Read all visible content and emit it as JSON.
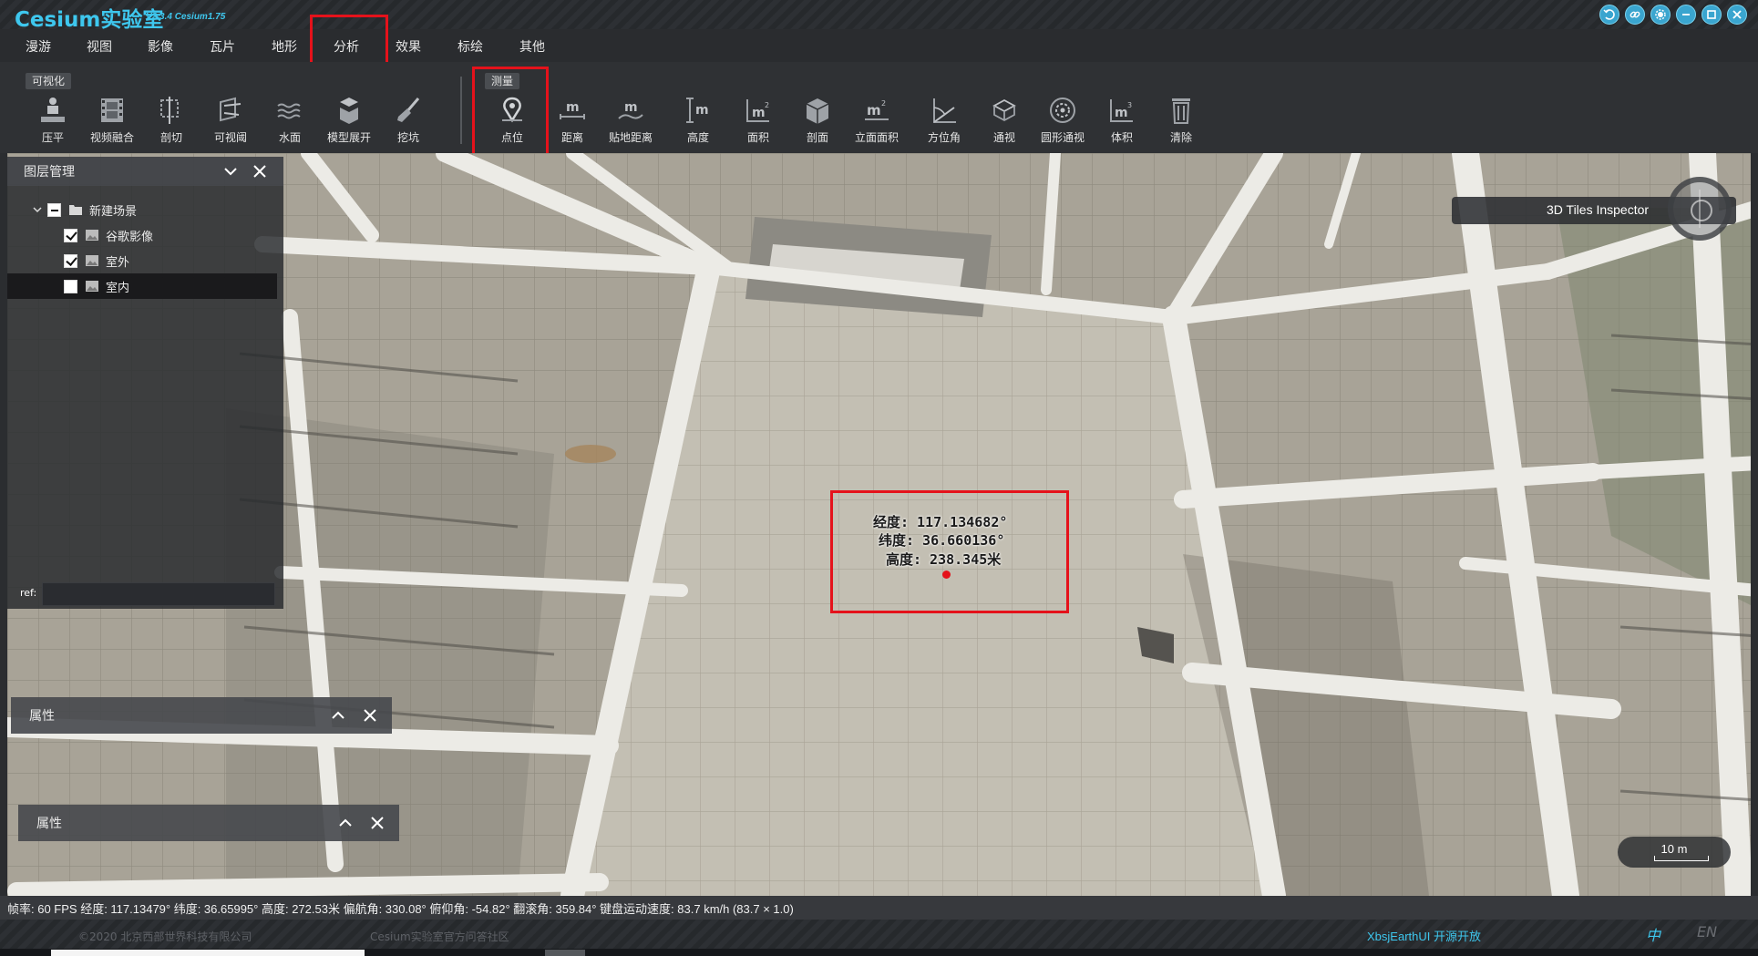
{
  "app": {
    "title": "Cesium实验室",
    "version": "V2.3.4  Cesium1.75"
  },
  "window_controls": [
    "undo-icon",
    "link-icon",
    "settings-icon",
    "minimize-icon",
    "maximize-icon",
    "close-icon"
  ],
  "menu": {
    "items": [
      "漫游",
      "视图",
      "影像",
      "瓦片",
      "地形",
      "分析",
      "效果",
      "标绘",
      "其他"
    ],
    "active": "分析"
  },
  "ribbon": {
    "group_visual": "可视化",
    "group_measure": "测量",
    "visual_tools": [
      "压平",
      "视频融合",
      "剖切",
      "可视阈",
      "水面",
      "模型展开",
      "挖坑"
    ],
    "measure_tools": [
      "点位",
      "距离",
      "贴地距离",
      "高度",
      "面积",
      "剖面",
      "立面面积",
      "方位角",
      "通视",
      "圆形通视",
      "体积",
      "清除"
    ]
  },
  "layer_panel": {
    "title": "图层管理",
    "root": "新建场景",
    "layers": [
      {
        "name": "谷歌影像",
        "checked": true
      },
      {
        "name": "室外",
        "checked": true
      },
      {
        "name": "室内",
        "checked": false
      }
    ],
    "ref_label": "ref:",
    "ref_value": ""
  },
  "property_panels": [
    "属性",
    "属性"
  ],
  "inspector": {
    "label": "3D Tiles Inspector"
  },
  "point_readout": {
    "lng": "经度: 117.134682°",
    "lat": "纬度: 36.660136°",
    "height": "高度: 238.345米"
  },
  "scale": {
    "label": "10 m"
  },
  "status_bar": "帧率: 60 FPS 经度: 117.13479° 纬度: 36.65995° 高度: 272.53米 偏航角: 330.08° 俯仰角: -54.82° 翻滚角: 359.84° 键盘运动速度: 83.7 km/h (83.7 × 1.0)",
  "footer": {
    "copyright": "©2020 北京西部世界科技有限公司",
    "community": "Cesium实验室官方问答社区",
    "open_source": "XbsjEarthUI 开源开放",
    "lang_zh": "中",
    "lang_en": "EN"
  },
  "colors": {
    "accent": "#3ec7ee",
    "highlight": "#e5121b",
    "panel": "#2f3134"
  }
}
